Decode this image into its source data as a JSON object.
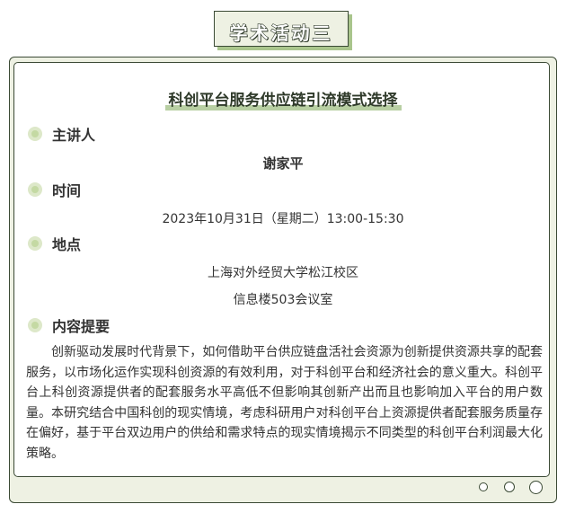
{
  "badge": {
    "title": "学术活动三"
  },
  "topic": {
    "title": "科创平台服务供应链引流模式选择"
  },
  "sections": {
    "speaker": {
      "label": "主讲人",
      "value": "谢家平"
    },
    "time": {
      "label": "时间",
      "value": "2023年10月31日（星期二）13:00-15:30"
    },
    "location": {
      "label": "地点",
      "line1": "上海对外经贸大学松江校区",
      "line2": "信息楼503会议室"
    },
    "summary": {
      "label": "内容提要",
      "text": "创新驱动发展时代背景下，如何借助平台供应链盘活社会资源为创新提供资源共享的配套服务，以市场化运作实现科创资源的有效利用，对于科创平台和经济社会的意义重大。科创平台上科创资源提供者的配套服务水平高低不但影响其创新产出而且也影响加入平台的用户数量。本研究结合中国科创的现实情境，考虑科研用户对科创平台上资源提供者配套服务质量存在偏好，基于平台双边用户的供给和需求特点的现实情境揭示不同类型的科创平台利润最大化策略。"
    }
  },
  "colors": {
    "accent_green": "#b8cfa3",
    "frame_bg": "#eef1e3",
    "border": "#3b4a35"
  }
}
